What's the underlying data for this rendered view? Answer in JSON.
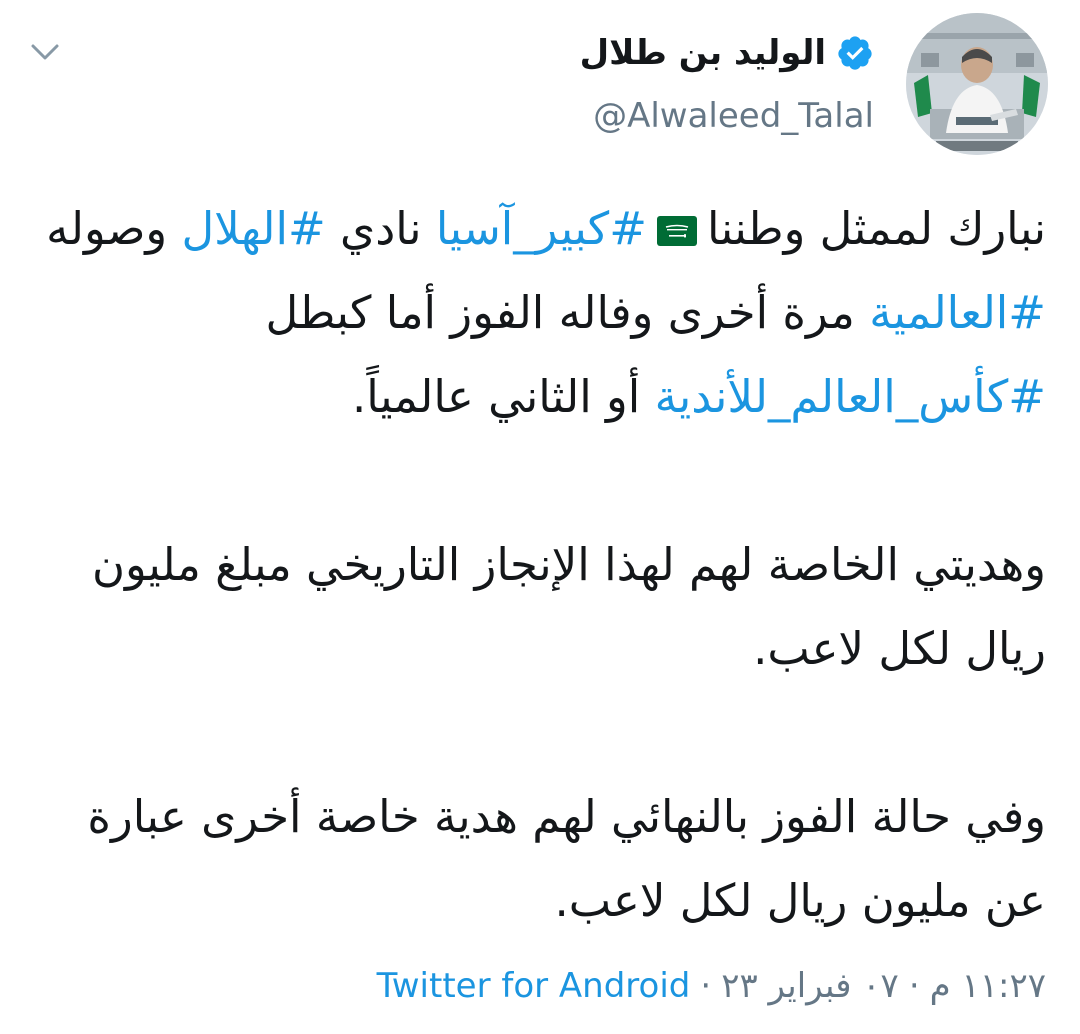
{
  "user": {
    "display_name": "الوليد بن طلال",
    "handle": "@Alwaleed_Talal",
    "verified_icon": "verified-badge-icon",
    "avatar_icon": "avatar-photo"
  },
  "menu": {
    "icon": "chevron-down-icon"
  },
  "tweet": {
    "p1": {
      "s1": "نبارك لممثل وطننا",
      "flag_icon": "saudi-flag-icon",
      "h1": "#كبير_آسيا",
      "s2": "نادي",
      "h2": "#الهلال",
      "s3": "وصوله",
      "h3": "#العالمية",
      "s4": "مرة أخرى وفاله الفوز أما كبطل",
      "h4": "#كأس_العالم_للأندية",
      "s5": "أو الثاني عالمياً."
    },
    "p2": "وهديتي الخاصة لهم لهذا الإنجاز التاريخي مبلغ مليون ريال لكل لاعب.",
    "p3": "وفي حالة الفوز بالنهائي لهم هدية خاصة أخرى عبارة عن مليون ريال لكل لاعب."
  },
  "meta": {
    "time": "١١:٢٧ م",
    "separator": "·",
    "date": "٠٧ فبراير ٢٣",
    "source": "Twitter for Android"
  },
  "colors": {
    "link": "#1b95e0",
    "secondary_text": "#657786",
    "primary_text": "#14171a",
    "flag_green": "#006c35"
  }
}
